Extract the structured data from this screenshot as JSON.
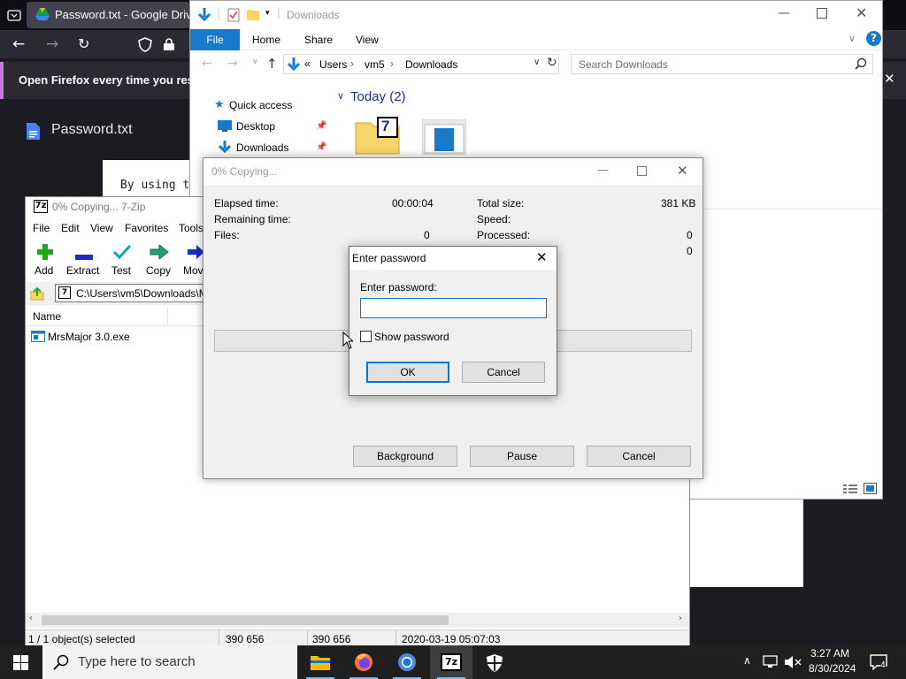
{
  "firefox": {
    "tab_title": "Password.txt - Google Drive",
    "notification_text": "Open Firefox every time you resta",
    "doc_title": "Password.txt",
    "doc_text": "By using t"
  },
  "explorer": {
    "title": "Downloads",
    "ribbon": [
      "File",
      "Home",
      "Share",
      "View"
    ],
    "breadcrumb": [
      "Users",
      "vm5",
      "Downloads"
    ],
    "search_placeholder": "Search Downloads",
    "nav_items": [
      "Quick access",
      "Desktop",
      "Downloads"
    ],
    "group_header": "Today (2)",
    "sevenzip_icon_text": "7"
  },
  "sevenzip": {
    "title": "0% Copying... 7-Zip",
    "menu": [
      "File",
      "Edit",
      "View",
      "Favorites",
      "Tools"
    ],
    "toolbar": [
      "Add",
      "Extract",
      "Test",
      "Copy",
      "Mov"
    ],
    "path": "C:\\Users\\vm5\\Downloads\\M",
    "column_name": "Name",
    "files": [
      {
        "name": "MrsMajor 3.0.exe"
      }
    ],
    "status": [
      "1 / 1 object(s) selected",
      "390 656",
      "390 656",
      "2020-03-19 05:07:03"
    ]
  },
  "copy_dialog": {
    "title": "0% Copying...",
    "elapsed_label": "Elapsed time:",
    "elapsed_value": "00:00:04",
    "remaining_label": "Remaining time:",
    "files_label": "Files:",
    "files_value": "0",
    "total_label": "Total size:",
    "total_value": "381 KB",
    "speed_label": "Speed:",
    "processed_label": "Processed:",
    "processed_value": "0",
    "compressed_value": "0",
    "progress_fraction": 0,
    "background_label": "Background",
    "pause_label": "Pause",
    "cancel_label": "Cancel"
  },
  "password_dialog": {
    "title": "Enter password",
    "label": "Enter password:",
    "value": "",
    "show_password_label": "Show password",
    "show_password_checked": false,
    "ok_label": "OK",
    "cancel_label": "Cancel"
  },
  "taskbar": {
    "search_placeholder": "Type here to search",
    "time": "3:27 AM",
    "date": "8/30/2024",
    "notification_count": "4"
  },
  "colors": {
    "accent": "#0078d7",
    "firefox_bg": "#1c1b22",
    "taskbar_bg": "#1f1f1f"
  }
}
